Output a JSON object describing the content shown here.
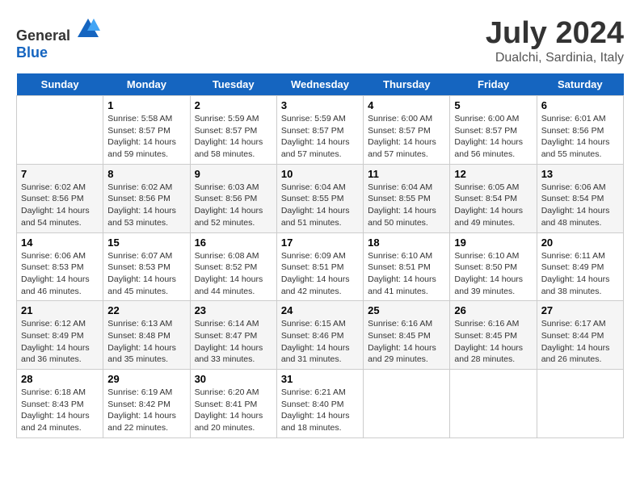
{
  "logo": {
    "text_general": "General",
    "text_blue": "Blue"
  },
  "title": "July 2024",
  "subtitle": "Dualchi, Sardinia, Italy",
  "days_of_week": [
    "Sunday",
    "Monday",
    "Tuesday",
    "Wednesday",
    "Thursday",
    "Friday",
    "Saturday"
  ],
  "weeks": [
    [
      {
        "day": "",
        "info": ""
      },
      {
        "day": "1",
        "info": "Sunrise: 5:58 AM\nSunset: 8:57 PM\nDaylight: 14 hours\nand 59 minutes."
      },
      {
        "day": "2",
        "info": "Sunrise: 5:59 AM\nSunset: 8:57 PM\nDaylight: 14 hours\nand 58 minutes."
      },
      {
        "day": "3",
        "info": "Sunrise: 5:59 AM\nSunset: 8:57 PM\nDaylight: 14 hours\nand 57 minutes."
      },
      {
        "day": "4",
        "info": "Sunrise: 6:00 AM\nSunset: 8:57 PM\nDaylight: 14 hours\nand 57 minutes."
      },
      {
        "day": "5",
        "info": "Sunrise: 6:00 AM\nSunset: 8:57 PM\nDaylight: 14 hours\nand 56 minutes."
      },
      {
        "day": "6",
        "info": "Sunrise: 6:01 AM\nSunset: 8:56 PM\nDaylight: 14 hours\nand 55 minutes."
      }
    ],
    [
      {
        "day": "7",
        "info": "Sunrise: 6:02 AM\nSunset: 8:56 PM\nDaylight: 14 hours\nand 54 minutes."
      },
      {
        "day": "8",
        "info": "Sunrise: 6:02 AM\nSunset: 8:56 PM\nDaylight: 14 hours\nand 53 minutes."
      },
      {
        "day": "9",
        "info": "Sunrise: 6:03 AM\nSunset: 8:56 PM\nDaylight: 14 hours\nand 52 minutes."
      },
      {
        "day": "10",
        "info": "Sunrise: 6:04 AM\nSunset: 8:55 PM\nDaylight: 14 hours\nand 51 minutes."
      },
      {
        "day": "11",
        "info": "Sunrise: 6:04 AM\nSunset: 8:55 PM\nDaylight: 14 hours\nand 50 minutes."
      },
      {
        "day": "12",
        "info": "Sunrise: 6:05 AM\nSunset: 8:54 PM\nDaylight: 14 hours\nand 49 minutes."
      },
      {
        "day": "13",
        "info": "Sunrise: 6:06 AM\nSunset: 8:54 PM\nDaylight: 14 hours\nand 48 minutes."
      }
    ],
    [
      {
        "day": "14",
        "info": "Sunrise: 6:06 AM\nSunset: 8:53 PM\nDaylight: 14 hours\nand 46 minutes."
      },
      {
        "day": "15",
        "info": "Sunrise: 6:07 AM\nSunset: 8:53 PM\nDaylight: 14 hours\nand 45 minutes."
      },
      {
        "day": "16",
        "info": "Sunrise: 6:08 AM\nSunset: 8:52 PM\nDaylight: 14 hours\nand 44 minutes."
      },
      {
        "day": "17",
        "info": "Sunrise: 6:09 AM\nSunset: 8:51 PM\nDaylight: 14 hours\nand 42 minutes."
      },
      {
        "day": "18",
        "info": "Sunrise: 6:10 AM\nSunset: 8:51 PM\nDaylight: 14 hours\nand 41 minutes."
      },
      {
        "day": "19",
        "info": "Sunrise: 6:10 AM\nSunset: 8:50 PM\nDaylight: 14 hours\nand 39 minutes."
      },
      {
        "day": "20",
        "info": "Sunrise: 6:11 AM\nSunset: 8:49 PM\nDaylight: 14 hours\nand 38 minutes."
      }
    ],
    [
      {
        "day": "21",
        "info": "Sunrise: 6:12 AM\nSunset: 8:49 PM\nDaylight: 14 hours\nand 36 minutes."
      },
      {
        "day": "22",
        "info": "Sunrise: 6:13 AM\nSunset: 8:48 PM\nDaylight: 14 hours\nand 35 minutes."
      },
      {
        "day": "23",
        "info": "Sunrise: 6:14 AM\nSunset: 8:47 PM\nDaylight: 14 hours\nand 33 minutes."
      },
      {
        "day": "24",
        "info": "Sunrise: 6:15 AM\nSunset: 8:46 PM\nDaylight: 14 hours\nand 31 minutes."
      },
      {
        "day": "25",
        "info": "Sunrise: 6:16 AM\nSunset: 8:45 PM\nDaylight: 14 hours\nand 29 minutes."
      },
      {
        "day": "26",
        "info": "Sunrise: 6:16 AM\nSunset: 8:45 PM\nDaylight: 14 hours\nand 28 minutes."
      },
      {
        "day": "27",
        "info": "Sunrise: 6:17 AM\nSunset: 8:44 PM\nDaylight: 14 hours\nand 26 minutes."
      }
    ],
    [
      {
        "day": "28",
        "info": "Sunrise: 6:18 AM\nSunset: 8:43 PM\nDaylight: 14 hours\nand 24 minutes."
      },
      {
        "day": "29",
        "info": "Sunrise: 6:19 AM\nSunset: 8:42 PM\nDaylight: 14 hours\nand 22 minutes."
      },
      {
        "day": "30",
        "info": "Sunrise: 6:20 AM\nSunset: 8:41 PM\nDaylight: 14 hours\nand 20 minutes."
      },
      {
        "day": "31",
        "info": "Sunrise: 6:21 AM\nSunset: 8:40 PM\nDaylight: 14 hours\nand 18 minutes."
      },
      {
        "day": "",
        "info": ""
      },
      {
        "day": "",
        "info": ""
      },
      {
        "day": "",
        "info": ""
      }
    ]
  ]
}
